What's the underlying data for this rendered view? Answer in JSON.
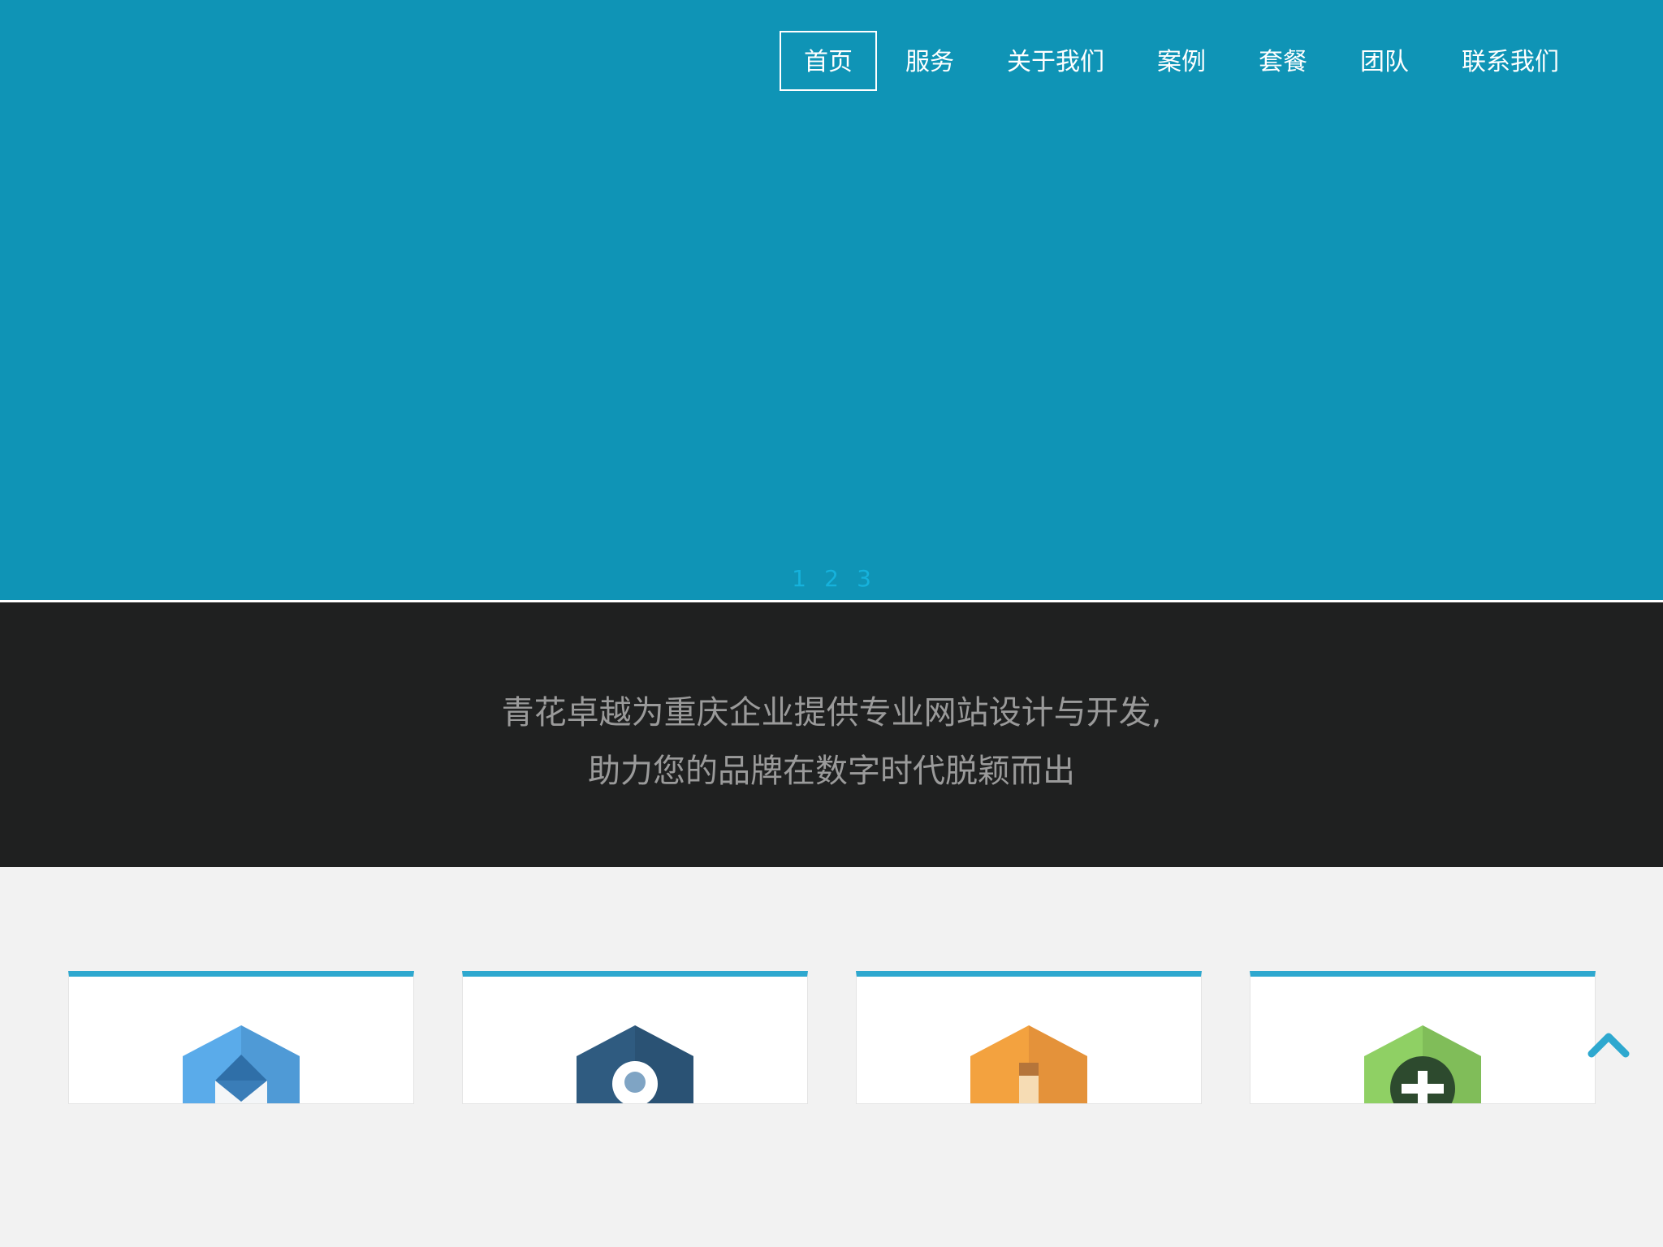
{
  "nav": {
    "items": [
      {
        "label": "首页",
        "active": true
      },
      {
        "label": "服务",
        "active": false
      },
      {
        "label": "关于我们",
        "active": false
      },
      {
        "label": "案例",
        "active": false
      },
      {
        "label": "套餐",
        "active": false
      },
      {
        "label": "团队",
        "active": false
      },
      {
        "label": "联系我们",
        "active": false
      }
    ]
  },
  "slider": {
    "pages": [
      "1",
      "2",
      "3"
    ],
    "background": "#0f94b6"
  },
  "tagline": {
    "line1": "青花卓越为重庆企业提供专业网站设计与开发,",
    "line2": "助力您的品牌在数字时代脱颖而出"
  },
  "services": [
    {
      "icon": "mail-icon",
      "color": "#5aabea"
    },
    {
      "icon": "location-pin-icon",
      "color": "#2f5b80"
    },
    {
      "icon": "pencil-icon",
      "color": "#f3a23f"
    },
    {
      "icon": "plus-circle-icon",
      "color": "#84c75a"
    }
  ],
  "colors": {
    "accent": "#2ea8cf",
    "dark_band": "#1f2020",
    "page_bg": "#f2f2f2"
  },
  "back_to_top": {
    "icon": "chevron-up-icon"
  }
}
